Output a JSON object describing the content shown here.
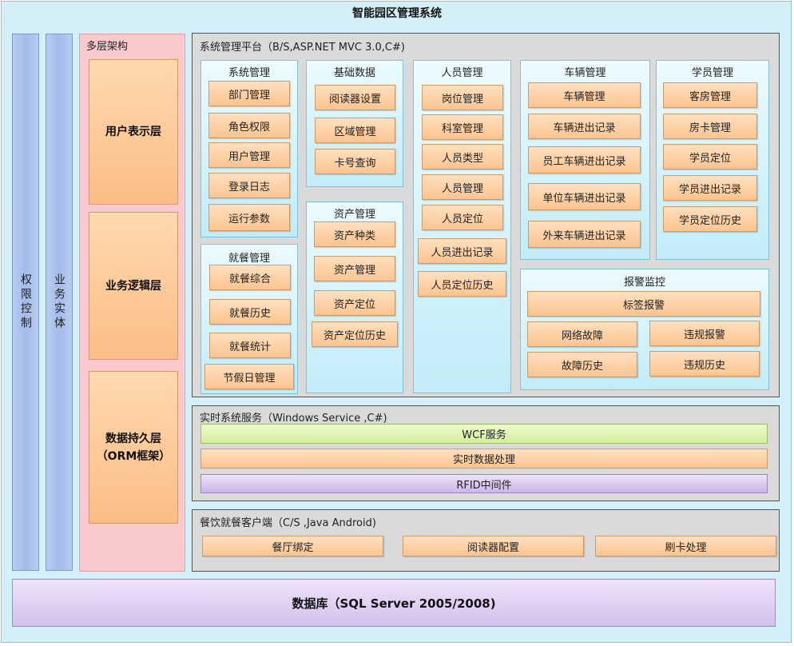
{
  "title": "智能园区管理系统",
  "side_bars": {
    "permission": "权限控制",
    "business_entity": "业务实体"
  },
  "multilayer": {
    "title": "多层架构",
    "layers": [
      "用户表示层",
      "业务逻辑层",
      "数据持久层\n（ORM框架）"
    ]
  },
  "platform": {
    "title": "系统管理平台（B/S,ASP.NET MVC 3.0,C#)",
    "groups": {
      "system": {
        "title": "系统管理",
        "items": [
          "部门管理",
          "角色权限",
          "用户管理",
          "登录日志",
          "运行参数"
        ]
      },
      "basic": {
        "title": "基础数据",
        "items": [
          "阅读器设置",
          "区域管理",
          "卡号查询"
        ]
      },
      "dining": {
        "title": "就餐管理",
        "items": [
          "就餐综合",
          "就餐历史",
          "就餐统计",
          "节假日管理"
        ]
      },
      "assets": {
        "title": "资产管理",
        "items": [
          "资产种类",
          "资产管理",
          "资产定位",
          "资产定位历史"
        ]
      },
      "personnel": {
        "title": "人员管理",
        "items": [
          "岗位管理",
          "科室管理",
          "人员类型",
          "人员管理",
          "人员定位",
          "人员进出记录",
          "人员定位历史"
        ]
      },
      "vehicles": {
        "title": "车辆管理",
        "items": [
          "车辆管理",
          "车辆进出记录",
          "员工车辆进出记录",
          "单位车辆进出记录",
          "外来车辆进出记录"
        ]
      },
      "students": {
        "title": "学员管理",
        "items": [
          "客房管理",
          "房卡管理",
          "学员定位",
          "学员进出记录",
          "学员定位历史"
        ]
      },
      "alarm": {
        "title": "报警监控",
        "items": [
          "标签报警",
          "网络故障",
          "违规报警",
          "故障历史",
          "违规历史"
        ]
      }
    }
  },
  "realtime": {
    "title": "实时系统服务（Windows Service ,C#)",
    "bars": [
      "WCF服务",
      "实时数据处理",
      "RFID中间件"
    ]
  },
  "client": {
    "title": "餐饮就餐客户端（C/S ,Java Android)",
    "items": [
      "餐厅绑定",
      "阅读器配置",
      "刷卡处理"
    ]
  },
  "database": "数据库（SQL Server 2005/2008)"
}
